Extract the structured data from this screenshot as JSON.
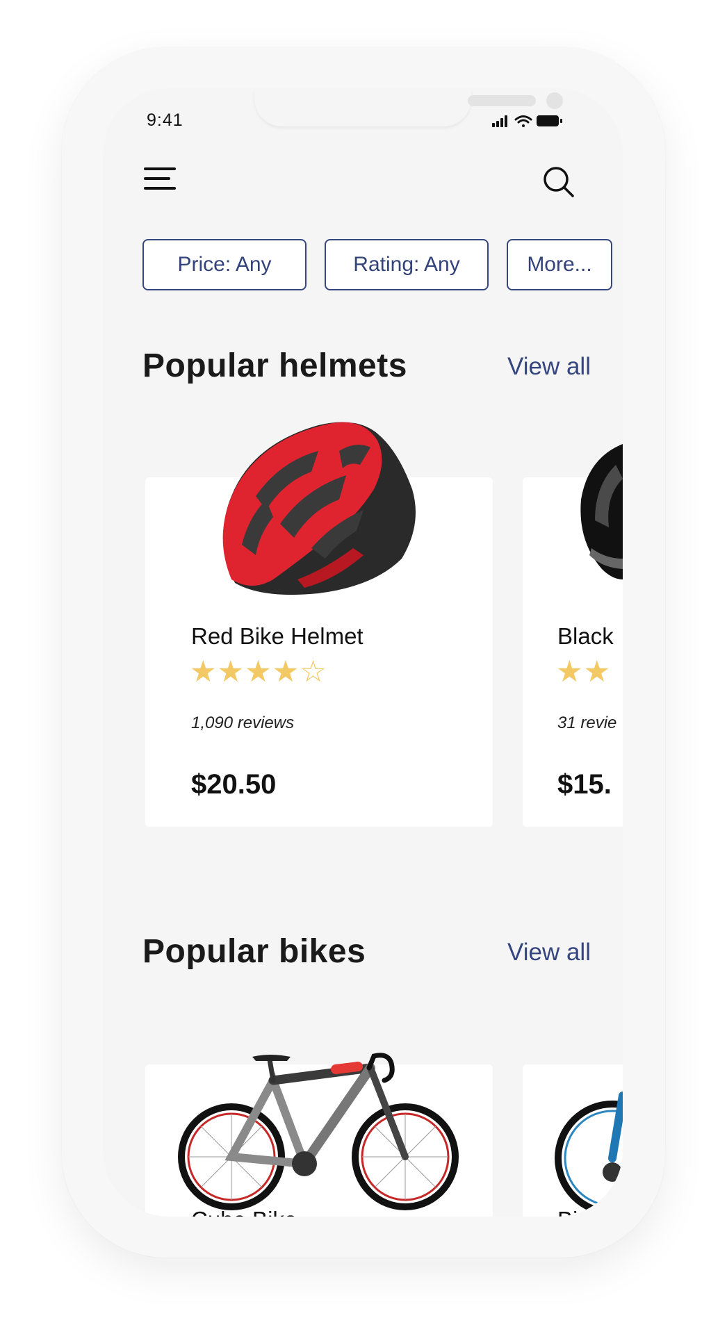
{
  "status_bar": {
    "time": "9:41"
  },
  "header": {
    "menu_icon": "menu-icon",
    "search_icon": "search-icon"
  },
  "filters": [
    {
      "label": "Price: Any"
    },
    {
      "label": "Rating: Any"
    },
    {
      "label": "More..."
    }
  ],
  "helmets": {
    "title": "Popular helmets",
    "view_all": "View all",
    "items": [
      {
        "name": "Red Bike Helmet",
        "rating": 4.5,
        "reviews": "1,090 reviews",
        "price": "$20.50",
        "color": "#e0242f"
      },
      {
        "name": "Black",
        "rating": 2,
        "reviews": "31 revie",
        "price": "$15.",
        "color": "#1a1a1a"
      }
    ]
  },
  "bikes": {
    "title": "Popular bikes",
    "view_all": "View all",
    "items": [
      {
        "name": "Cube Bike"
      },
      {
        "name": "Bi"
      }
    ]
  },
  "colors": {
    "accent": "#34457f",
    "star": "#f3c965",
    "background": "#f5f5f5",
    "card": "#ffffff"
  }
}
